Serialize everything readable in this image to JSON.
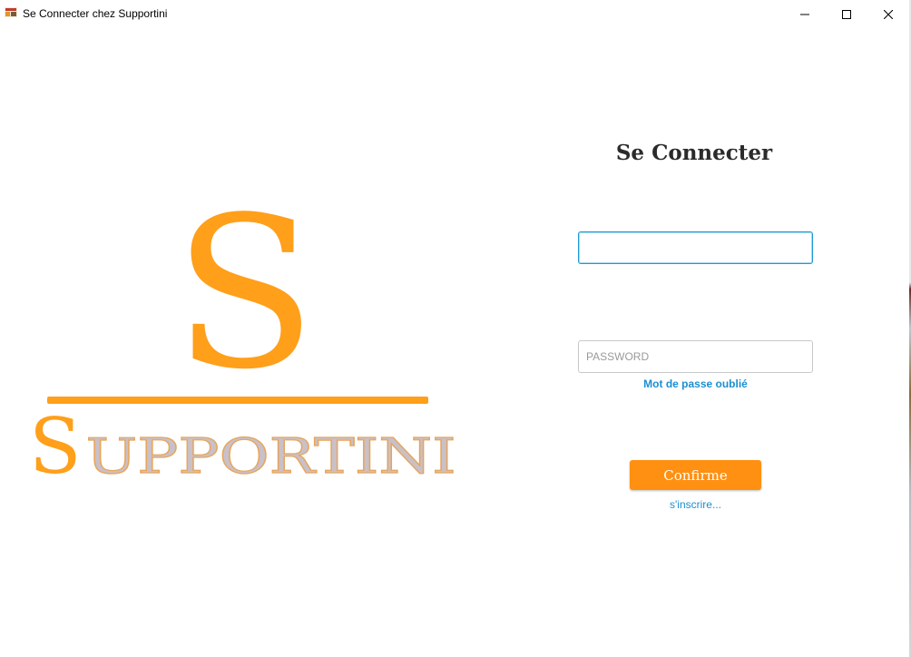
{
  "window": {
    "title": "Se Connecter chez Supportini"
  },
  "logo": {
    "monogram": "S",
    "wordmark_first": "S",
    "wordmark_rest": "UPPORTINI",
    "colors": {
      "orange": "#ff9f1a",
      "silver": "#c9c0c8",
      "outline": "#e8a458"
    }
  },
  "form": {
    "title": "Se Connecter",
    "username": {
      "value": "",
      "placeholder": ""
    },
    "password": {
      "value": "",
      "placeholder": "PASSWORD"
    },
    "forgot_label": "Mot de passe oublié",
    "confirm_label": "Confirme",
    "signup_label": "s'inscrire..."
  },
  "colors": {
    "accent": "#ff9012",
    "link": "#1b8fd0",
    "focus": "#1e9ad6"
  },
  "icons": {
    "app": "app-icon",
    "minimize": "minimize-icon",
    "maximize": "maximize-icon",
    "close": "close-icon"
  }
}
